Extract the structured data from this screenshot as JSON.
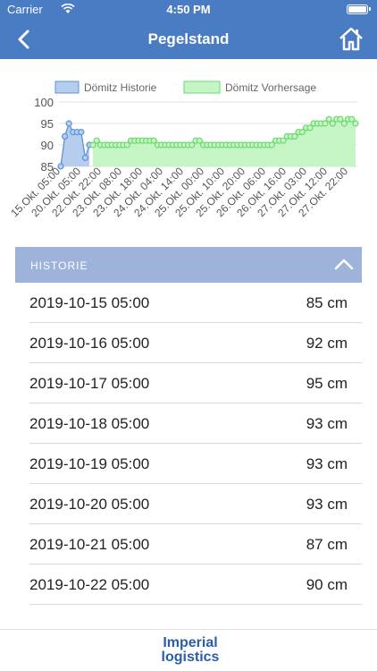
{
  "status": {
    "carrier": "Carrier",
    "time": "4:50 PM"
  },
  "nav": {
    "title": "Pegelstand"
  },
  "legend": {
    "history": "Dömitz Historie",
    "forecast": "Dömitz Vorhersage"
  },
  "colors": {
    "primary": "#4a7cc3",
    "section_header": "#9db3d9",
    "history_line": "#5b93d8",
    "history_fill": "#b7cdee",
    "forecast_line": "#6bd96b",
    "forecast_fill": "#c5f5c5"
  },
  "chart_data": {
    "type": "line",
    "ylim": [
      85,
      100
    ],
    "yticks": [
      85,
      90,
      95,
      100
    ],
    "xticks": [
      "15.Okt. 05:00",
      "20.Okt. 05:00",
      "22.Okt. 22:00",
      "23.Okt. 08:00",
      "23.Okt. 18:00",
      "24.Okt. 04:00",
      "24.Okt. 14:00",
      "25.Okt. 00:00",
      "25.Okt. 10:00",
      "25.Okt. 20:00",
      "26.Okt. 06:00",
      "26.Okt. 16:00",
      "27.Okt. 03:00",
      "27.Okt. 12:00",
      "27.Okt. 22:00"
    ],
    "series": [
      {
        "name": "Dömitz Historie",
        "values": [
          85,
          92,
          95,
          93,
          93,
          93,
          87,
          90
        ]
      },
      {
        "name": "Dömitz Vorhersage",
        "values": [
          90,
          91,
          90,
          90,
          90,
          90,
          90,
          90,
          90,
          90,
          91,
          91,
          91,
          91,
          91,
          91,
          91,
          90,
          90,
          90,
          90,
          90,
          90,
          90,
          90,
          90,
          90,
          91,
          91,
          90,
          90,
          90,
          90,
          90,
          90,
          90,
          90,
          90,
          90,
          90,
          90,
          90,
          90,
          90,
          90,
          90,
          90,
          90,
          91,
          91,
          91,
          92,
          92,
          92,
          93,
          93,
          94,
          94,
          95,
          95,
          95,
          95,
          96,
          95,
          96,
          96,
          95,
          96,
          96,
          95
        ]
      }
    ]
  },
  "section": {
    "title": "HISTORIE"
  },
  "rows": [
    {
      "date": "2019-10-15 05:00",
      "value": "85 cm"
    },
    {
      "date": "2019-10-16 05:00",
      "value": "92 cm"
    },
    {
      "date": "2019-10-17 05:00",
      "value": "95 cm"
    },
    {
      "date": "2019-10-18 05:00",
      "value": "93 cm"
    },
    {
      "date": "2019-10-19 05:00",
      "value": "93 cm"
    },
    {
      "date": "2019-10-20 05:00",
      "value": "93 cm"
    },
    {
      "date": "2019-10-21 05:00",
      "value": "87 cm"
    },
    {
      "date": "2019-10-22 05:00",
      "value": "90 cm"
    }
  ],
  "footer": {
    "logo_line1": "Imperial",
    "logo_line2": "logistics"
  }
}
